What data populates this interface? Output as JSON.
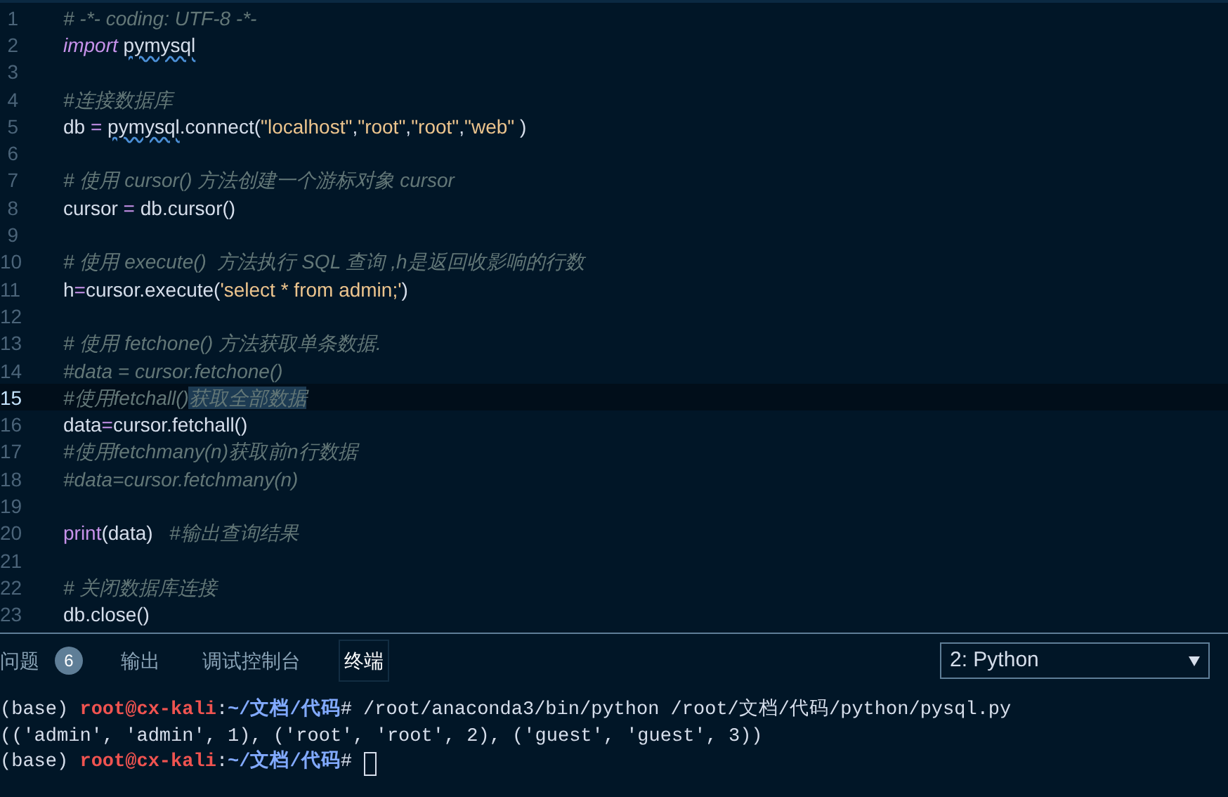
{
  "editor": {
    "lines": [
      {
        "number": "1",
        "current": false,
        "tokens": [
          {
            "kind": "comment",
            "text": "# -*- coding: UTF-8 -*-"
          }
        ]
      },
      {
        "number": "2",
        "current": false,
        "tokens": [
          {
            "kind": "keyword",
            "text": "import "
          },
          {
            "kind": "warning",
            "text": "pymysql"
          }
        ]
      },
      {
        "number": "3",
        "current": false
      },
      {
        "number": "4",
        "current": false,
        "tokens": [
          {
            "kind": "comment",
            "text": "#连接数据库"
          }
        ]
      },
      {
        "number": "5",
        "current": false,
        "tokens": [
          {
            "kind": "plain",
            "text": "db "
          },
          {
            "kind": "operator",
            "text": "= "
          },
          {
            "kind": "warning",
            "text": "pymysql"
          },
          {
            "kind": "plain",
            "text": ".connect("
          },
          {
            "kind": "string",
            "text": "\"localhost\""
          },
          {
            "kind": "plain",
            "text": ","
          },
          {
            "kind": "string",
            "text": "\"root\""
          },
          {
            "kind": "plain",
            "text": ","
          },
          {
            "kind": "string",
            "text": "\"root\""
          },
          {
            "kind": "plain",
            "text": ","
          },
          {
            "kind": "string",
            "text": "\"web\""
          },
          {
            "kind": "plain",
            "text": " )"
          }
        ]
      },
      {
        "number": "6",
        "current": false
      },
      {
        "number": "7",
        "current": false,
        "tokens": [
          {
            "kind": "comment",
            "text": "# 使用 cursor() 方法创建一个游标对象 cursor"
          }
        ]
      },
      {
        "number": "8",
        "current": false,
        "tokens": [
          {
            "kind": "plain",
            "text": "cursor "
          },
          {
            "kind": "operator",
            "text": "="
          },
          {
            "kind": "plain",
            "text": " db.cursor()"
          }
        ]
      },
      {
        "number": "9",
        "current": false
      },
      {
        "number": "10",
        "current": false,
        "tokens": [
          {
            "kind": "comment",
            "text": "# 使用 execute()  方法执行 SQL 查询 ,h是返回收影响的行数"
          }
        ]
      },
      {
        "number": "11",
        "current": false,
        "tokens": [
          {
            "kind": "plain",
            "text": "h"
          },
          {
            "kind": "operator",
            "text": "="
          },
          {
            "kind": "plain",
            "text": "cursor.execute("
          },
          {
            "kind": "string",
            "text": "'select * from admin;'"
          },
          {
            "kind": "plain",
            "text": ")"
          }
        ]
      },
      {
        "number": "12",
        "current": false
      },
      {
        "number": "13",
        "current": false,
        "tokens": [
          {
            "kind": "comment",
            "text": "# 使用 fetchone() 方法获取单条数据."
          }
        ]
      },
      {
        "number": "14",
        "current": false,
        "tokens": [
          {
            "kind": "comment",
            "text": "#data = cursor.fetchone()"
          }
        ]
      },
      {
        "number": "15",
        "current": true,
        "tokens": [
          {
            "kind": "comment",
            "text": "#使用fetchall()"
          },
          {
            "kind": "selected-comment",
            "text": "获取全部数据"
          }
        ]
      },
      {
        "number": "16",
        "current": false,
        "tokens": [
          {
            "kind": "plain",
            "text": "data"
          },
          {
            "kind": "operator",
            "text": "="
          },
          {
            "kind": "plain",
            "text": "cursor.fetchall()"
          }
        ]
      },
      {
        "number": "17",
        "current": false,
        "tokens": [
          {
            "kind": "comment",
            "text": "#使用fetchmany(n)获取前n行数据"
          }
        ]
      },
      {
        "number": "18",
        "current": false,
        "tokens": [
          {
            "kind": "comment",
            "text": "#data=cursor.fetchmany(n)"
          }
        ]
      },
      {
        "number": "19",
        "current": false
      },
      {
        "number": "20",
        "current": false,
        "tokens": [
          {
            "kind": "keyword-plain",
            "text": "print"
          },
          {
            "kind": "plain",
            "text": "(data)   "
          },
          {
            "kind": "comment",
            "text": "#输出查询结果"
          }
        ]
      },
      {
        "number": "21",
        "current": false
      },
      {
        "number": "22",
        "current": false,
        "tokens": [
          {
            "kind": "comment",
            "text": "# 关闭数据库连接"
          }
        ]
      },
      {
        "number": "23",
        "current": false,
        "tokens": [
          {
            "kind": "plain",
            "text": "db.close()"
          }
        ]
      }
    ]
  },
  "panel": {
    "tabs": [
      {
        "label": "问题",
        "badge": "6",
        "selected": false
      },
      {
        "label": "输出",
        "selected": false
      },
      {
        "label": "调试控制台",
        "selected": false
      },
      {
        "label": "终端",
        "selected": true
      }
    ],
    "terminal_select": {
      "value": "2: Python"
    },
    "terminal": [
      {
        "segments": [
          {
            "kind": "plain",
            "text": "(base) "
          },
          {
            "kind": "user",
            "text": "root@cx-kali"
          },
          {
            "kind": "plain",
            "text": ":"
          },
          {
            "kind": "path",
            "text": "~/文档/代码"
          },
          {
            "kind": "plain",
            "text": "# /root/anaconda3/bin/python /root/文档/代码/python/pysql.py"
          }
        ],
        "cursor": false
      },
      {
        "segments": [
          {
            "kind": "plain",
            "text": "(('admin', 'admin', 1), ('root', 'root', 2), ('guest', 'guest', 3))"
          }
        ],
        "cursor": false
      },
      {
        "segments": [
          {
            "kind": "plain",
            "text": "(base) "
          },
          {
            "kind": "user",
            "text": "root@cx-kali"
          },
          {
            "kind": "plain",
            "text": ":"
          },
          {
            "kind": "path",
            "text": "~/文档/代码"
          },
          {
            "kind": "plain",
            "text": "# "
          }
        ],
        "cursor": true
      }
    ]
  }
}
